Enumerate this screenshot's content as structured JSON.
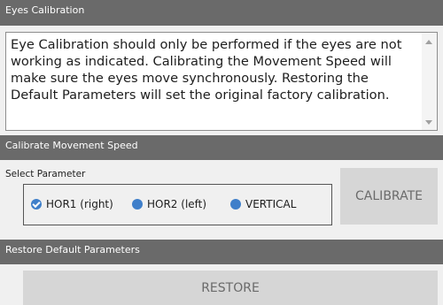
{
  "eyes_calibration": {
    "title": "Eyes Calibration",
    "description": "Eye Calibration should only be performed if the eyes are not working as indicated. Calibrating the Movement Speed will make sure the eyes move synchronously. Restoring the Default Parameters will set the original factory calibration."
  },
  "movement_speed": {
    "title": "Calibrate Movement Speed",
    "select_label": "Select Parameter",
    "parameters": [
      {
        "label": "HOR1 (right)",
        "selected": true
      },
      {
        "label": "HOR2 (left)",
        "selected": false
      },
      {
        "label": "VERTICAL",
        "selected": false
      }
    ],
    "calibrate_label": "CALIBRATE"
  },
  "restore_defaults": {
    "title": "Restore Default Parameters",
    "restore_label": "RESTORE"
  },
  "colors": {
    "header_bg": "#6a6a6a",
    "radio_accent": "#3f7fca",
    "button_bg": "#d6d6d6",
    "button_text": "#6a6a6a"
  }
}
